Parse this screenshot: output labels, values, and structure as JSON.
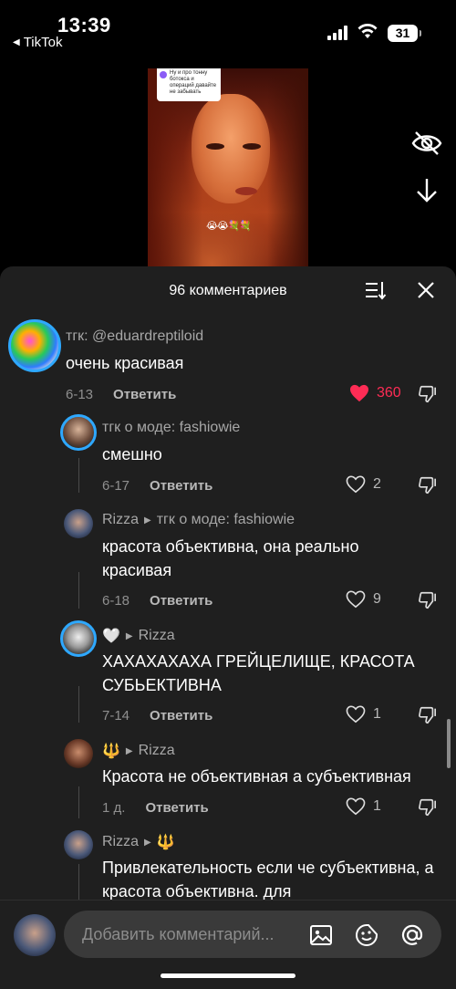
{
  "status_bar": {
    "time": "13:39",
    "back_app": "TikTok",
    "battery": "31"
  },
  "video": {
    "sticker_text": "Ну и про тонну ботокса и операций давайте не забывать",
    "emojis": "😭😭💐💐"
  },
  "side_actions": {
    "hide": "eye-off-icon",
    "download": "download-icon"
  },
  "comments_header": {
    "title": "96 комментариев"
  },
  "comments": [
    {
      "author": "тгк: @eduardreptiloid",
      "text": "очень красивая",
      "date": "6-13",
      "reply": "Ответить",
      "likes": "360",
      "liked": true
    },
    {
      "author": "тгк о моде: fashiowie",
      "text": "смешно",
      "date": "6-17",
      "reply": "Ответить",
      "likes": "2",
      "liked": false
    },
    {
      "author": "Rizza",
      "reply_to": "тгк о моде: fashiowie",
      "text": "красота объективна, она реально красивая",
      "date": "6-18",
      "reply": "Ответить",
      "likes": "9",
      "liked": false
    },
    {
      "author_emoji": "🤍",
      "reply_to": "Rizza",
      "text": "ХАХАХАХАХА ГРЕЙЦЕЛИЩЕ, КРАСОТА СУБЬЕКТИВНА",
      "date": "7-14",
      "reply": "Ответить",
      "likes": "1",
      "liked": false
    },
    {
      "author_emoji": "🔱",
      "reply_to": "Rizza",
      "text": "Красота не объективная а субъективная",
      "date": "1 д.",
      "reply": "Ответить",
      "likes": "1",
      "liked": false
    },
    {
      "author": "Rizza",
      "reply_to_emoji": "🔱",
      "text": "Привлекательность если че субъективна, а красота объективна. для"
    }
  ],
  "composer": {
    "placeholder": "Добавить комментарий..."
  },
  "colors": {
    "like_red": "#fe2c55",
    "ring_blue": "#2ea8ff",
    "sheet_bg": "#1f1f1f"
  }
}
